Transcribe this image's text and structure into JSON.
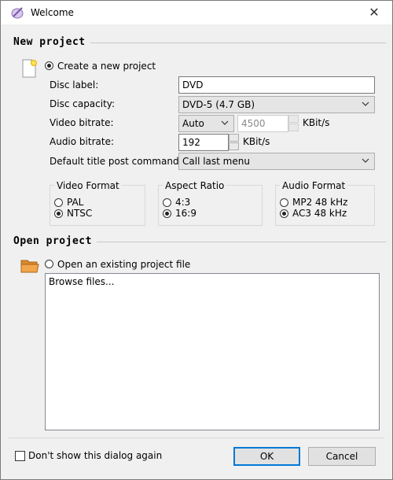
{
  "window": {
    "title": "Welcome",
    "close_glyph": "✕"
  },
  "new_project": {
    "heading": "New project",
    "create_radio_label": "Create a new project",
    "create_selected": true,
    "disc_label": {
      "label": "Disc label:",
      "value": "DVD"
    },
    "disc_capacity": {
      "label": "Disc capacity:",
      "value": "DVD-5 (4.7 GB)"
    },
    "video_bitrate": {
      "label": "Video bitrate:",
      "mode": "Auto",
      "value": "4500",
      "unit": "KBit/s"
    },
    "audio_bitrate": {
      "label": "Audio bitrate:",
      "value": "192",
      "unit": "KBit/s"
    },
    "default_post_command": {
      "label": "Default title post command:",
      "value": "Call last menu"
    },
    "video_format": {
      "title": "Video Format",
      "options": [
        "PAL",
        "NTSC"
      ],
      "selected": "NTSC"
    },
    "aspect_ratio": {
      "title": "Aspect Ratio",
      "options": [
        "4:3",
        "16:9"
      ],
      "selected": "16:9"
    },
    "audio_format": {
      "title": "Audio Format",
      "options": [
        "MP2 48 kHz",
        "AC3 48 kHz"
      ],
      "selected": "AC3 48 kHz"
    }
  },
  "open_project": {
    "heading": "Open project",
    "open_radio_label": "Open an existing project file",
    "open_selected": false,
    "file_list": [
      "Browse files..."
    ]
  },
  "footer": {
    "dont_show_label": "Don't show this dialog again",
    "dont_show_checked": false,
    "ok_label": "OK",
    "cancel_label": "Cancel"
  },
  "icons": {
    "app": "dvd-author-icon",
    "new_project": "new-document-icon",
    "open_project": "folder-icon"
  }
}
